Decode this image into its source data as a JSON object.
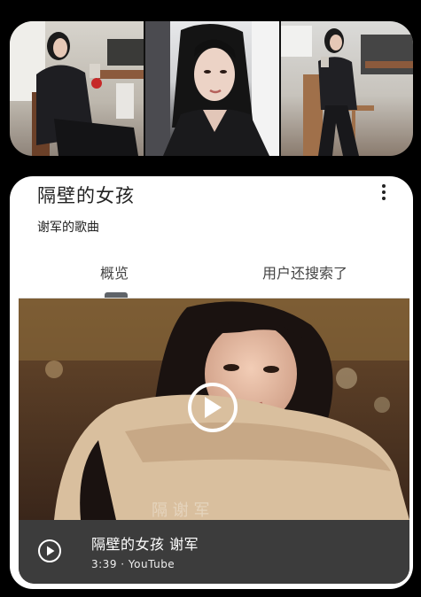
{
  "photos": [
    {
      "name": "photo-woman-sitting-with-cup"
    },
    {
      "name": "photo-woman-portrait"
    },
    {
      "name": "photo-woman-on-stool"
    }
  ],
  "card": {
    "title": "隔壁的女孩",
    "subtitle": "谢军的歌曲",
    "more_icon": "more-vert-icon",
    "tabs": [
      {
        "label": "概览",
        "active": true
      },
      {
        "label": "用户还搜索了",
        "active": false
      }
    ]
  },
  "video": {
    "title": "隔壁的女孩 谢军",
    "meta": "3:39 · YouTube",
    "play_icon": "play-icon"
  }
}
